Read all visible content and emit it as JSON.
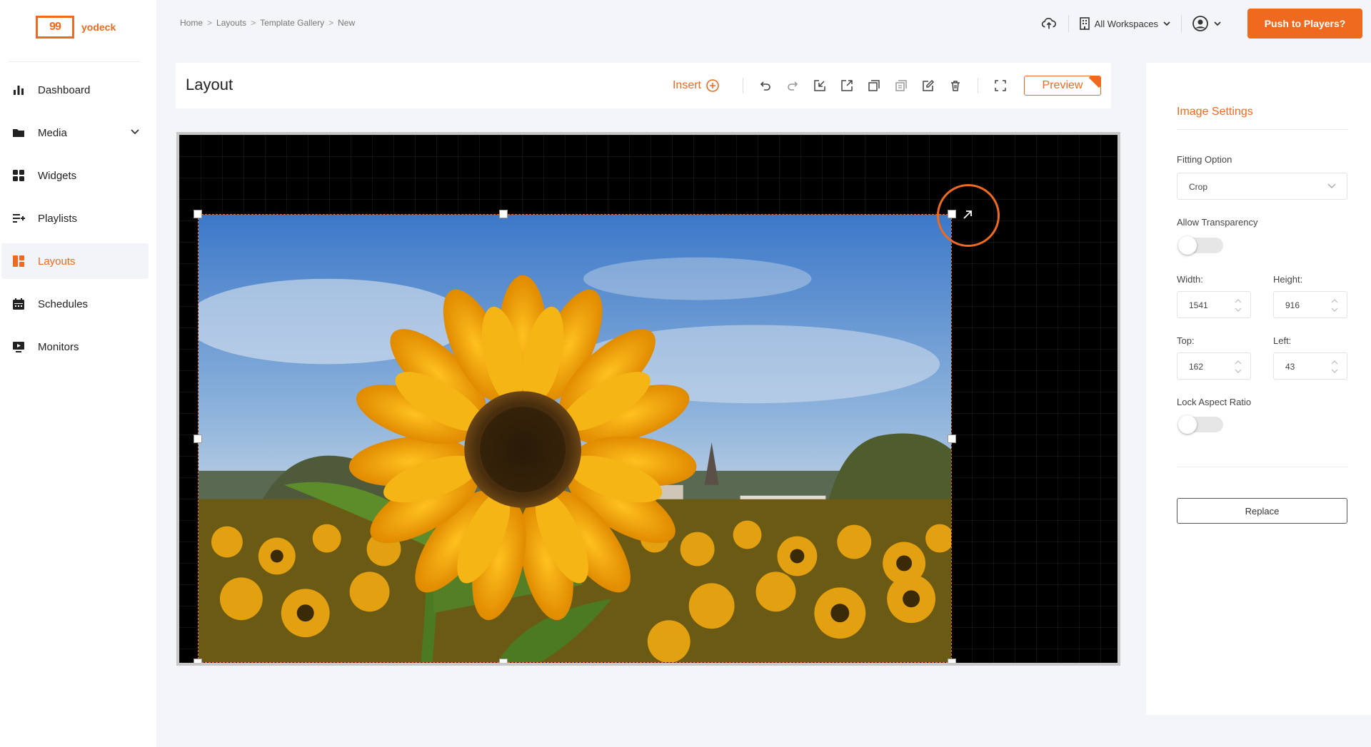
{
  "app": {
    "logo_text": "yodeck",
    "logo_glyph": "99",
    "brand_color": "#ef6a1f"
  },
  "sidebar": {
    "items": [
      {
        "label": "Dashboard",
        "icon": "bar-chart-icon"
      },
      {
        "label": "Media",
        "icon": "folder-icon",
        "has_chevron": true
      },
      {
        "label": "Widgets",
        "icon": "widgets-icon"
      },
      {
        "label": "Playlists",
        "icon": "playlist-add-icon"
      },
      {
        "label": "Layouts",
        "icon": "layouts-icon",
        "active": true
      },
      {
        "label": "Schedules",
        "icon": "calendar-icon"
      },
      {
        "label": "Monitors",
        "icon": "monitor-icon"
      }
    ]
  },
  "breadcrumb": {
    "items": [
      "Home",
      "Layouts",
      "Template Gallery",
      "New"
    ],
    "separator": ">"
  },
  "topbar": {
    "workspace_label": "All Workspaces",
    "push_label": "Push to Players?"
  },
  "layout": {
    "title": "Layout",
    "insert_label": "Insert",
    "preview_label": "Preview"
  },
  "panel": {
    "title": "Image Settings",
    "fitting_label": "Fitting Option",
    "fitting_value": "Crop",
    "transparency_label": "Allow Transparency",
    "transparency_on": false,
    "width_label": "Width:",
    "width_value": "1541",
    "height_label": "Height:",
    "height_value": "916",
    "top_label": "Top:",
    "top_value": "162",
    "left_label": "Left:",
    "left_value": "43",
    "lock_label": "Lock Aspect Ratio",
    "lock_on": false,
    "replace_label": "Replace"
  }
}
